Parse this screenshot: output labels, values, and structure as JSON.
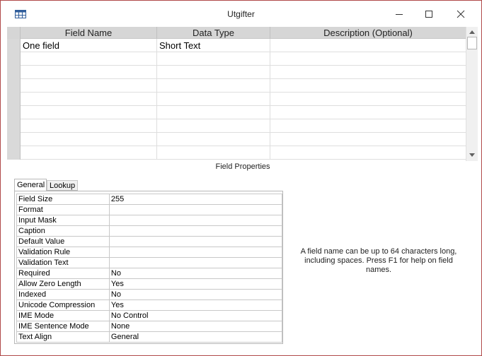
{
  "window": {
    "title": "Utgifter"
  },
  "grid": {
    "columns": [
      "Field Name",
      "Data Type",
      "Description (Optional)"
    ],
    "rows": [
      {
        "field_name": "One field",
        "data_type": "Short Text",
        "description": ""
      }
    ],
    "empty_rows": 8
  },
  "field_properties": {
    "title": "Field Properties",
    "tabs": [
      "General",
      "Lookup"
    ],
    "active_tab": "General",
    "properties": [
      {
        "label": "Field Size",
        "value": "255"
      },
      {
        "label": "Format",
        "value": ""
      },
      {
        "label": "Input Mask",
        "value": ""
      },
      {
        "label": "Caption",
        "value": ""
      },
      {
        "label": "Default Value",
        "value": ""
      },
      {
        "label": "Validation Rule",
        "value": ""
      },
      {
        "label": "Validation Text",
        "value": ""
      },
      {
        "label": "Required",
        "value": "No"
      },
      {
        "label": "Allow Zero Length",
        "value": "Yes"
      },
      {
        "label": "Indexed",
        "value": "No"
      },
      {
        "label": "Unicode Compression",
        "value": "Yes"
      },
      {
        "label": "IME Mode",
        "value": "No Control"
      },
      {
        "label": "IME Sentence Mode",
        "value": "None"
      },
      {
        "label": "Text Align",
        "value": "General"
      }
    ],
    "help_text": "A field name can be up to 64 characters long, including spaces. Press F1 for help on field names."
  },
  "icons": [
    "table-icon",
    "minimize-icon",
    "maximize-icon",
    "close-icon",
    "scroll-up-icon",
    "scroll-down-icon"
  ],
  "colors": {
    "window_border": "#b04a4a",
    "header_bg": "#d6d6d6",
    "selector_bg": "#d9d9d9"
  }
}
